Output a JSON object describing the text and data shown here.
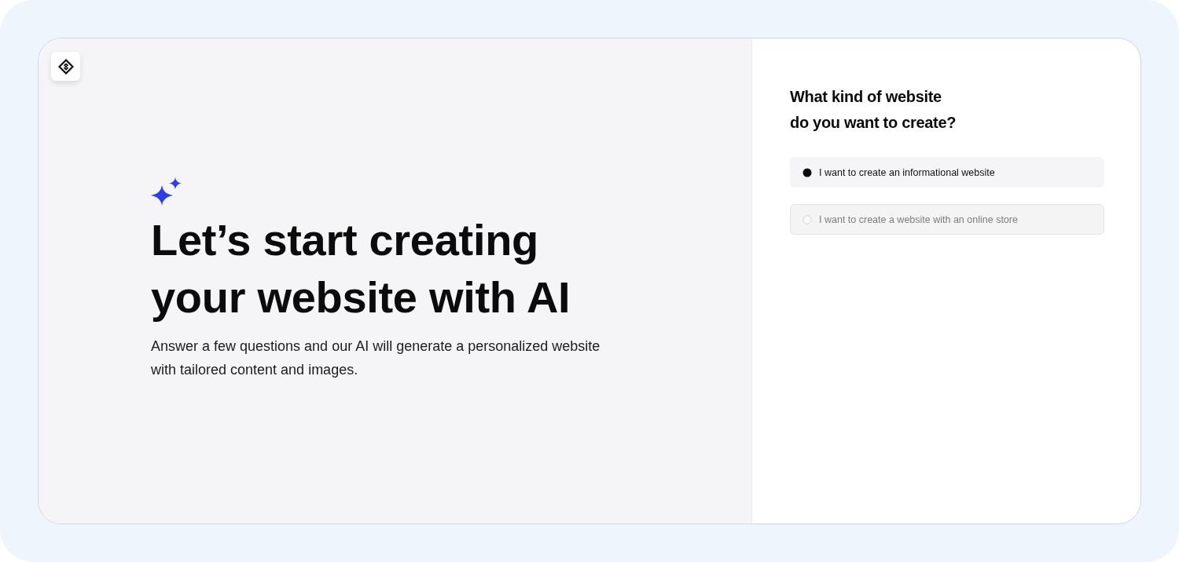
{
  "hero": {
    "title": "Let’s start creating\nyour website with AI",
    "subtitle": "Answer a few questions and our AI will generate a personalized website\nwith tailored content and images."
  },
  "question": {
    "title": "What kind of website\ndo you want to create?",
    "options": [
      {
        "label": "I want to create an informational website",
        "selected": true
      },
      {
        "label": "I want to create a website with an online store",
        "selected": false
      }
    ]
  }
}
